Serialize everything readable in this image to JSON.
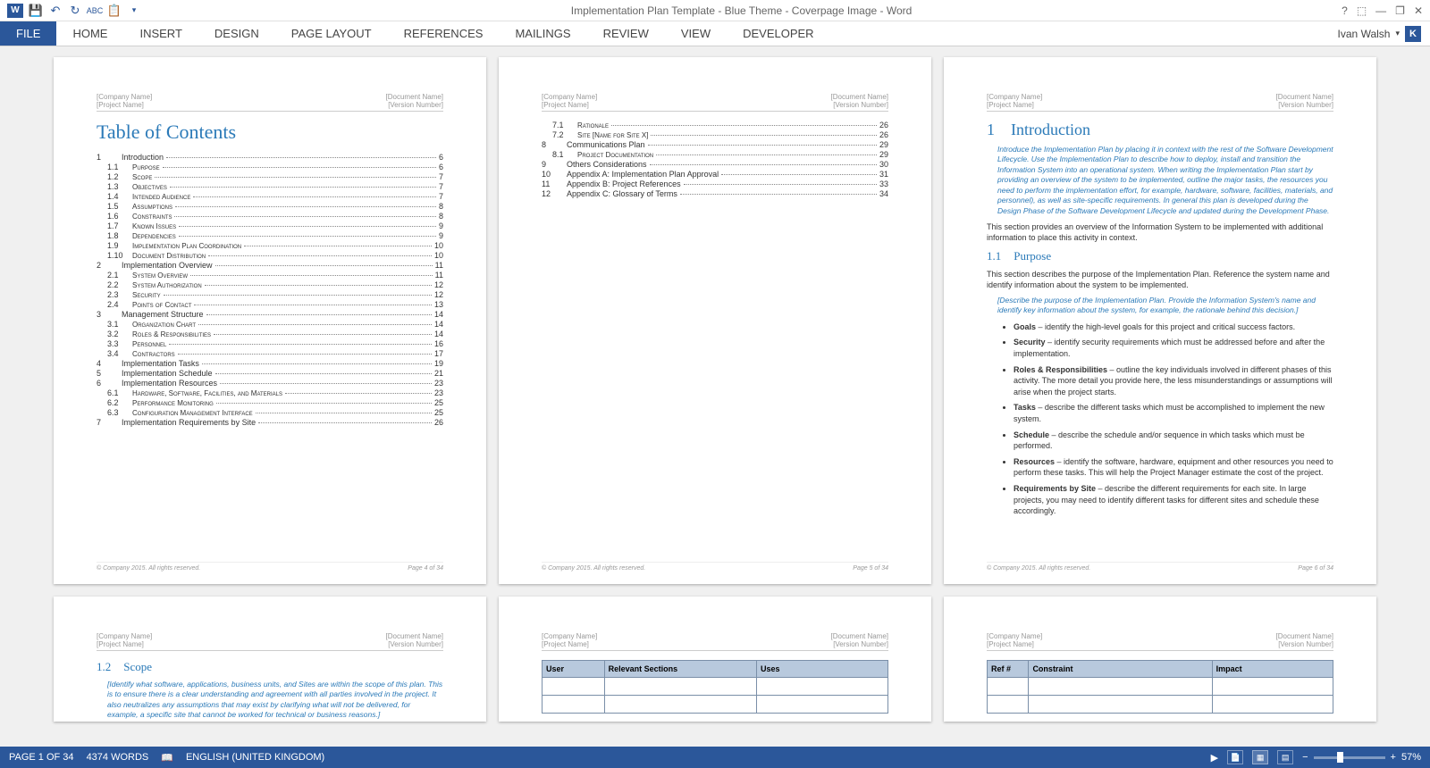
{
  "title": "Implementation Plan Template - Blue Theme - Coverpage Image - Word",
  "user": {
    "name": "Ivan Walsh",
    "initial": "K"
  },
  "ribbon": {
    "file": "FILE",
    "tabs": [
      "HOME",
      "INSERT",
      "DESIGN",
      "PAGE LAYOUT",
      "REFERENCES",
      "MAILINGS",
      "REVIEW",
      "VIEW",
      "DEVELOPER"
    ]
  },
  "pageHeader": {
    "left1": "[Company Name]",
    "left2": "[Project Name]",
    "right1": "[Document Name]",
    "right2": "[Version Number]"
  },
  "footer": {
    "left": "© Company 2015. All rights reserved.",
    "p4": "Page 4 of 34",
    "p5": "Page 5 of 34",
    "p6": "Page 6 of 34"
  },
  "toc": {
    "heading": "Table of Contents",
    "page1": [
      {
        "n": "1",
        "t": "Introduction",
        "p": "6",
        "lvl": 1
      },
      {
        "n": "1.1",
        "t": "Purpose",
        "p": "6",
        "lvl": 2,
        "sc": 1
      },
      {
        "n": "1.2",
        "t": "Scope",
        "p": "7",
        "lvl": 2,
        "sc": 1
      },
      {
        "n": "1.3",
        "t": "Objectives",
        "p": "7",
        "lvl": 2,
        "sc": 1
      },
      {
        "n": "1.4",
        "t": "Intended Audience",
        "p": "7",
        "lvl": 2,
        "sc": 1
      },
      {
        "n": "1.5",
        "t": "Assumptions",
        "p": "8",
        "lvl": 2,
        "sc": 1
      },
      {
        "n": "1.6",
        "t": "Constraints",
        "p": "8",
        "lvl": 2,
        "sc": 1
      },
      {
        "n": "1.7",
        "t": "Known Issues",
        "p": "9",
        "lvl": 2,
        "sc": 1
      },
      {
        "n": "1.8",
        "t": "Dependencies",
        "p": "9",
        "lvl": 2,
        "sc": 1
      },
      {
        "n": "1.9",
        "t": "Implementation Plan Coordination",
        "p": "10",
        "lvl": 2,
        "sc": 1
      },
      {
        "n": "1.10",
        "t": "Document Distribution",
        "p": "10",
        "lvl": 2,
        "sc": 1
      },
      {
        "n": "2",
        "t": "Implementation Overview",
        "p": "11",
        "lvl": 1
      },
      {
        "n": "2.1",
        "t": "System Overview",
        "p": "11",
        "lvl": 2,
        "sc": 1
      },
      {
        "n": "2.2",
        "t": "System Authorization",
        "p": "12",
        "lvl": 2,
        "sc": 1
      },
      {
        "n": "2.3",
        "t": "Security",
        "p": "12",
        "lvl": 2,
        "sc": 1
      },
      {
        "n": "2.4",
        "t": "Points of Contact",
        "p": "13",
        "lvl": 2,
        "sc": 1
      },
      {
        "n": "3",
        "t": "Management Structure",
        "p": "14",
        "lvl": 1
      },
      {
        "n": "3.1",
        "t": "Organization Chart",
        "p": "14",
        "lvl": 2,
        "sc": 1
      },
      {
        "n": "3.2",
        "t": "Roles & Responsibilities",
        "p": "14",
        "lvl": 2,
        "sc": 1
      },
      {
        "n": "3.3",
        "t": "Personnel",
        "p": "16",
        "lvl": 2,
        "sc": 1
      },
      {
        "n": "3.4",
        "t": "Contractors",
        "p": "17",
        "lvl": 2,
        "sc": 1
      },
      {
        "n": "4",
        "t": "Implementation Tasks",
        "p": "19",
        "lvl": 1
      },
      {
        "n": "5",
        "t": "Implementation Schedule",
        "p": "21",
        "lvl": 1
      },
      {
        "n": "6",
        "t": "Implementation Resources",
        "p": "23",
        "lvl": 1
      },
      {
        "n": "6.1",
        "t": "Hardware, Software, Facilities, and Materials",
        "p": "23",
        "lvl": 2,
        "sc": 1
      },
      {
        "n": "6.2",
        "t": "Performance Monitoring",
        "p": "25",
        "lvl": 2,
        "sc": 1
      },
      {
        "n": "6.3",
        "t": "Configuration Management Interface",
        "p": "25",
        "lvl": 2,
        "sc": 1
      },
      {
        "n": "7",
        "t": "Implementation Requirements by Site",
        "p": "26",
        "lvl": 1
      }
    ],
    "page2": [
      {
        "n": "7.1",
        "t": "Rationale",
        "p": "26",
        "lvl": 2,
        "sc": 1
      },
      {
        "n": "7.2",
        "t": "Site [Name for Site X]",
        "p": "26",
        "lvl": 2,
        "sc": 1
      },
      {
        "n": "8",
        "t": "Communications Plan",
        "p": "29",
        "lvl": 1
      },
      {
        "n": "8.1",
        "t": "Project Documentation",
        "p": "29",
        "lvl": 2,
        "sc": 1
      },
      {
        "n": "9",
        "t": "Others Considerations",
        "p": "30",
        "lvl": 1
      },
      {
        "n": "10",
        "t": "Appendix A: Implementation Plan Approval",
        "p": "31",
        "lvl": 1
      },
      {
        "n": "11",
        "t": "Appendix B: Project References",
        "p": "33",
        "lvl": 1
      },
      {
        "n": "12",
        "t": "Appendix C: Glossary of Terms",
        "p": "34",
        "lvl": 1
      }
    ]
  },
  "intro": {
    "num": "1",
    "title": "Introduction",
    "instrText": "Introduce the Implementation Plan by placing it in context with the rest of the Software Development Lifecycle. Use the Implementation Plan to describe how to deploy, install and transition the Information System into an operational system. When writing the Implementation Plan start by providing an overview of the system to be implemented, outline the major tasks, the resources you need to perform the implementation effort, for example, hardware, software, facilities, materials, and personnel), as well as site-specific requirements. In general this plan is developed during the Design Phase of the Software Development Lifecycle and updated during the Development Phase.",
    "para1": "This section provides an overview of the Information System to be implemented with additional information to place this activity in context.",
    "sub1num": "1.1",
    "sub1title": "Purpose",
    "sub1para": "This section describes the purpose of the Implementation Plan. Reference the system name and identify information about the system to be implemented.",
    "sub1instr": "[Describe the purpose of the Implementation Plan. Provide the Information System's name and identify key information about the system, for example, the rationale behind this decision.]",
    "bullets": [
      {
        "b": "Goals",
        "t": " – identify the high-level goals for this project and critical success factors."
      },
      {
        "b": "Security",
        "t": " – identify security requirements which must be addressed before and after the implementation."
      },
      {
        "b": "Roles & Responsibilities",
        "t": " – outline the key individuals involved in different phases of this activity. The more detail you provide here, the less misunderstandings or assumptions will arise when the project starts."
      },
      {
        "b": "Tasks",
        "t": " – describe the different tasks which must be accomplished to implement the new system."
      },
      {
        "b": "Schedule",
        "t": " – describe the schedule and/or sequence in which tasks which must be performed."
      },
      {
        "b": "Resources",
        "t": " – identify the software, hardware, equipment and other resources you need to perform these tasks. This will help the Project Manager estimate the cost of the project."
      },
      {
        "b": "Requirements by Site",
        "t": " – describe the different requirements for each site. In large projects, you may need to identify different tasks for different sites and schedule these accordingly."
      }
    ]
  },
  "scope": {
    "num": "1.2",
    "title": "Scope",
    "instr": "[Identify what software, applications, business units, and Sites are within the scope of this plan. This is to ensure there is a clear understanding and agreement with all parties involved in the project. It also neutralizes any assumptions that may exist by clarifying what will not be delivered, for example, a specific site that cannot be worked for technical or business reasons.]"
  },
  "table1": {
    "h1": "User",
    "h2": "Relevant Sections",
    "h3": "Uses"
  },
  "table2": {
    "h1": "Ref #",
    "h2": "Constraint",
    "h3": "Impact"
  },
  "status": {
    "page": "PAGE 1 OF 34",
    "words": "4374 WORDS",
    "lang": "ENGLISH (UNITED KINGDOM)",
    "zoom": "57%"
  }
}
